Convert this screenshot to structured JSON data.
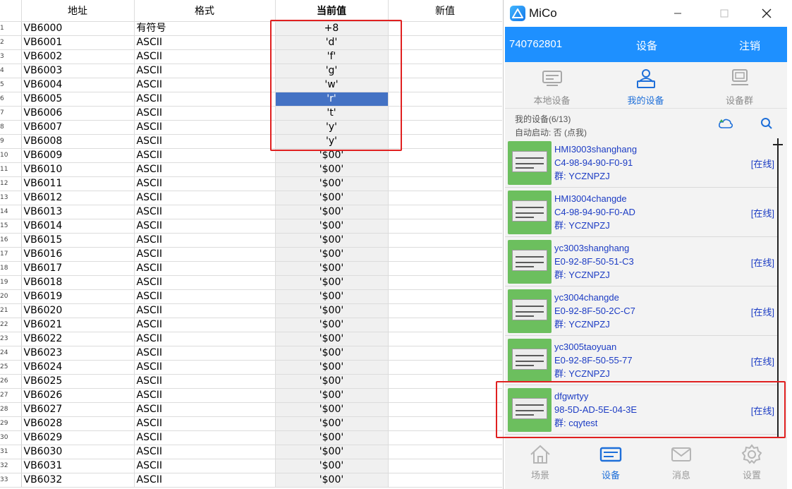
{
  "table": {
    "headers": {
      "address": "地址",
      "format": "格式",
      "current_value": "当前值",
      "new_value": "新值"
    },
    "selected_row": 5,
    "rows": [
      {
        "idx": "1",
        "address": "VB6000",
        "format": "有符号",
        "value": "+8"
      },
      {
        "idx": "2",
        "address": "VB6001",
        "format": "ASCII",
        "value": "'d'"
      },
      {
        "idx": "3",
        "address": "VB6002",
        "format": "ASCII",
        "value": "'f'"
      },
      {
        "idx": "4",
        "address": "VB6003",
        "format": "ASCII",
        "value": "'g'"
      },
      {
        "idx": "5",
        "address": "VB6004",
        "format": "ASCII",
        "value": "'w'"
      },
      {
        "idx": "6",
        "address": "VB6005",
        "format": "ASCII",
        "value": "'r'"
      },
      {
        "idx": "7",
        "address": "VB6006",
        "format": "ASCII",
        "value": "'t'"
      },
      {
        "idx": "8",
        "address": "VB6007",
        "format": "ASCII",
        "value": "'y'"
      },
      {
        "idx": "9",
        "address": "VB6008",
        "format": "ASCII",
        "value": "'y'"
      },
      {
        "idx": "10",
        "address": "VB6009",
        "format": "ASCII",
        "value": "'$00'"
      },
      {
        "idx": "11",
        "address": "VB6010",
        "format": "ASCII",
        "value": "'$00'"
      },
      {
        "idx": "12",
        "address": "VB6011",
        "format": "ASCII",
        "value": "'$00'"
      },
      {
        "idx": "13",
        "address": "VB6012",
        "format": "ASCII",
        "value": "'$00'"
      },
      {
        "idx": "14",
        "address": "VB6013",
        "format": "ASCII",
        "value": "'$00'"
      },
      {
        "idx": "15",
        "address": "VB6014",
        "format": "ASCII",
        "value": "'$00'"
      },
      {
        "idx": "16",
        "address": "VB6015",
        "format": "ASCII",
        "value": "'$00'"
      },
      {
        "idx": "17",
        "address": "VB6016",
        "format": "ASCII",
        "value": "'$00'"
      },
      {
        "idx": "18",
        "address": "VB6017",
        "format": "ASCII",
        "value": "'$00'"
      },
      {
        "idx": "19",
        "address": "VB6018",
        "format": "ASCII",
        "value": "'$00'"
      },
      {
        "idx": "20",
        "address": "VB6019",
        "format": "ASCII",
        "value": "'$00'"
      },
      {
        "idx": "21",
        "address": "VB6020",
        "format": "ASCII",
        "value": "'$00'"
      },
      {
        "idx": "22",
        "address": "VB6021",
        "format": "ASCII",
        "value": "'$00'"
      },
      {
        "idx": "23",
        "address": "VB6022",
        "format": "ASCII",
        "value": "'$00'"
      },
      {
        "idx": "24",
        "address": "VB6023",
        "format": "ASCII",
        "value": "'$00'"
      },
      {
        "idx": "25",
        "address": "VB6024",
        "format": "ASCII",
        "value": "'$00'"
      },
      {
        "idx": "26",
        "address": "VB6025",
        "format": "ASCII",
        "value": "'$00'"
      },
      {
        "idx": "27",
        "address": "VB6026",
        "format": "ASCII",
        "value": "'$00'"
      },
      {
        "idx": "28",
        "address": "VB6027",
        "format": "ASCII",
        "value": "'$00'"
      },
      {
        "idx": "29",
        "address": "VB6028",
        "format": "ASCII",
        "value": "'$00'"
      },
      {
        "idx": "30",
        "address": "VB6029",
        "format": "ASCII",
        "value": "'$00'"
      },
      {
        "idx": "31",
        "address": "VB6030",
        "format": "ASCII",
        "value": "'$00'"
      },
      {
        "idx": "32",
        "address": "VB6031",
        "format": "ASCII",
        "value": "'$00'"
      },
      {
        "idx": "33",
        "address": "VB6032",
        "format": "ASCII",
        "value": "'$00'"
      }
    ]
  },
  "mico": {
    "title": "MiCo",
    "account": "740762801",
    "top_title": "设备",
    "logout": "注销",
    "subtabs": [
      {
        "label": "本地设备",
        "icon": "local-device-icon"
      },
      {
        "label": "我的设备",
        "icon": "my-device-icon"
      },
      {
        "label": "设备群",
        "icon": "device-group-icon"
      }
    ],
    "active_subtab": 1,
    "device_count": "我的设备(6/13)",
    "autostart": "自动启动: 否 (点我)",
    "devices": [
      {
        "name": "HMI3003shanghang",
        "mac": "C4-98-94-90-F0-91",
        "group": "群: YCZNPZJ",
        "status": "[在线]"
      },
      {
        "name": "HMI3004changde",
        "mac": "C4-98-94-90-F0-AD",
        "group": "群: YCZNPZJ",
        "status": "[在线]"
      },
      {
        "name": "yc3003shanghang",
        "mac": "E0-92-8F-50-51-C3",
        "group": "群: YCZNPZJ",
        "status": "[在线]"
      },
      {
        "name": "yc3004changde",
        "mac": "E0-92-8F-50-2C-C7",
        "group": "群: YCZNPZJ",
        "status": "[在线]"
      },
      {
        "name": "yc3005taoyuan",
        "mac": "E0-92-8F-50-55-77",
        "group": "群: YCZNPZJ",
        "status": "[在线]"
      },
      {
        "name": "dfgwrtyy",
        "mac": "98-5D-AD-5E-04-3E",
        "group": "群: cqytest",
        "status": "[在线]"
      }
    ],
    "bottom_tabs": [
      {
        "label": "场景",
        "icon": "home-icon"
      },
      {
        "label": "设备",
        "icon": "device-icon"
      },
      {
        "label": "消息",
        "icon": "mail-icon"
      },
      {
        "label": "设置",
        "icon": "gear-icon"
      }
    ],
    "active_bottom_tab": 1,
    "colors": {
      "accent": "#1e90ff",
      "active": "#1e6fd9",
      "device_text": "#1c3cc4",
      "highlight": "#e02020"
    }
  }
}
